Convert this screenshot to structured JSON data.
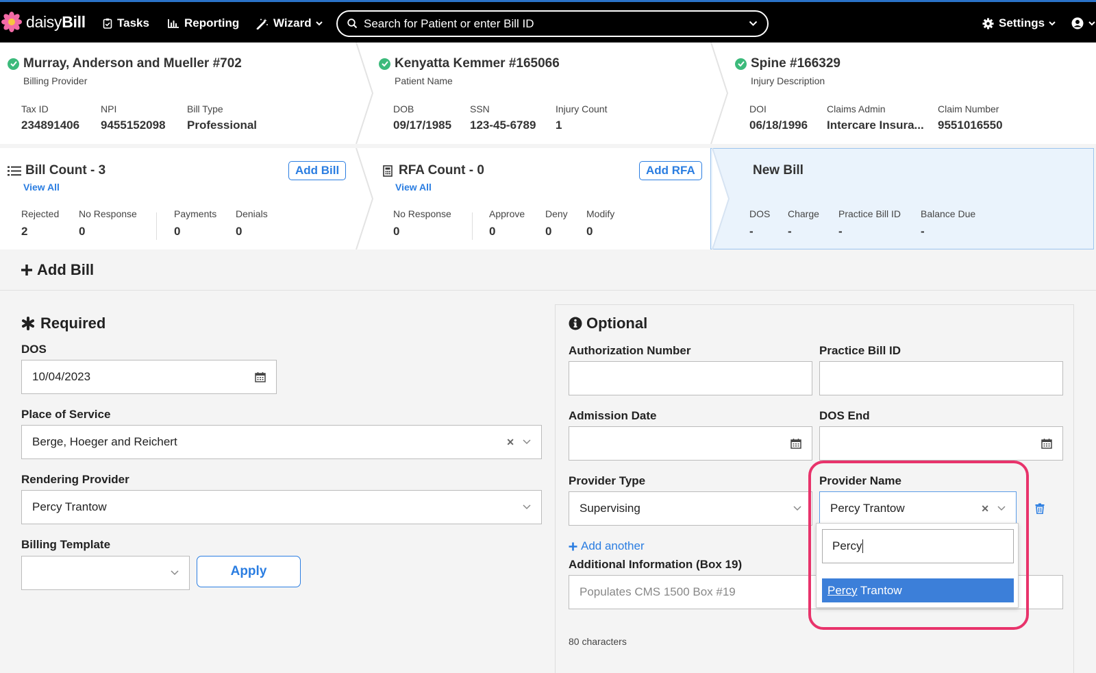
{
  "nav": {
    "brand_light": "daisy",
    "brand_bold": "Bill",
    "tasks": "Tasks",
    "reporting": "Reporting",
    "wizard": "Wizard",
    "search_placeholder": "Search for Patient or enter Bill ID",
    "settings": "Settings"
  },
  "billing_provider": {
    "name": "Murray, Anderson and Mueller #702",
    "subtitle": "Billing Provider",
    "tax_id_label": "Tax ID",
    "tax_id": "234891406",
    "npi_label": "NPI",
    "npi": "9455152098",
    "bill_type_label": "Bill Type",
    "bill_type": "Professional"
  },
  "patient": {
    "name": "Kenyatta Kemmer #165066",
    "subtitle": "Patient Name",
    "dob_label": "DOB",
    "dob": "09/17/1985",
    "ssn_label": "SSN",
    "ssn": "123-45-6789",
    "injury_count_label": "Injury Count",
    "injury_count": "1"
  },
  "injury": {
    "name": "Spine #166329",
    "subtitle": "Injury Description",
    "doi_label": "DOI",
    "doi": "06/18/1996",
    "claims_admin_label": "Claims Admin",
    "claims_admin": "Intercare Insura...",
    "claim_number_label": "Claim Number",
    "claim_number": "9551016550"
  },
  "bills": {
    "title": "Bill Count - 3",
    "view_all": "View All",
    "add_button": "Add Bill",
    "rejected_label": "Rejected",
    "rejected": "2",
    "no_response_label": "No Response",
    "no_response": "0",
    "payments_label": "Payments",
    "payments": "0",
    "denials_label": "Denials",
    "denials": "0"
  },
  "rfa": {
    "title": "RFA Count - 0",
    "view_all": "View All",
    "add_button": "Add RFA",
    "no_response_label": "No Response",
    "no_response": "0",
    "approve_label": "Approve",
    "approve": "0",
    "deny_label": "Deny",
    "deny": "0",
    "modify_label": "Modify",
    "modify": "0"
  },
  "new_bill": {
    "title": "New Bill",
    "dos_label": "DOS",
    "dos": "-",
    "charge_label": "Charge",
    "charge": "-",
    "practice_bill_id_label": "Practice Bill ID",
    "practice_bill_id": "-",
    "balance_due_label": "Balance Due",
    "balance_due": "-"
  },
  "add_bill": {
    "title": "Add Bill"
  },
  "required": {
    "title": "Required",
    "dos_label": "DOS",
    "dos": "10/04/2023",
    "place_of_service_label": "Place of Service",
    "place_of_service": "Berge, Hoeger and Reichert",
    "rendering_provider_label": "Rendering Provider",
    "rendering_provider": "Percy Trantow",
    "billing_template_label": "Billing Template",
    "billing_template": "",
    "apply_button": "Apply"
  },
  "optional": {
    "title": "Optional",
    "authorization_number_label": "Authorization Number",
    "practice_bill_id_label": "Practice Bill ID",
    "admission_date_label": "Admission Date",
    "dos_end_label": "DOS End",
    "provider_type_label": "Provider Type",
    "provider_type": "Supervising",
    "provider_name_label": "Provider Name",
    "provider_name": "Percy Trantow",
    "add_another": "Add another",
    "additional_info_label": "Additional Information (Box 19)",
    "additional_info_placeholder": "Populates CMS 1500 Box #19",
    "char_count": "80 characters"
  },
  "provider_dropdown": {
    "search_value": "Percy",
    "option_match": "Percy",
    "option_rest": " Trantow"
  },
  "colors": {
    "accent": "#2a7de1",
    "success": "#3cba7b",
    "highlight": "#e8336b",
    "new_bill_bg": "#eaf3fc"
  }
}
